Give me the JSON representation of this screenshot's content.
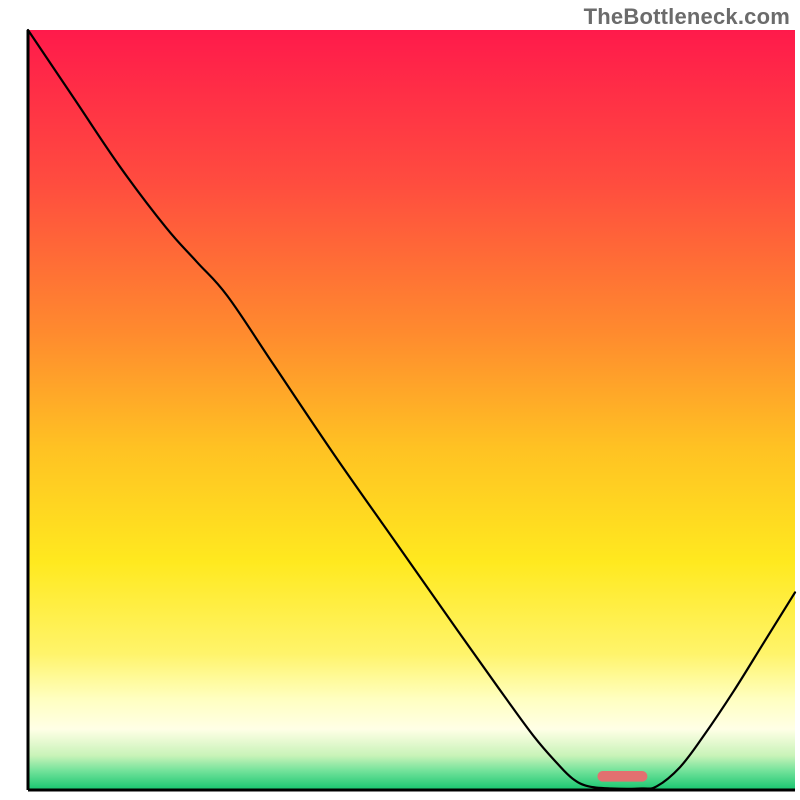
{
  "watermark": "TheBottleneck.com",
  "chart_data": {
    "type": "line",
    "title": "",
    "xlabel": "",
    "ylabel": "",
    "xlim": [
      0,
      100
    ],
    "ylim": [
      0,
      100
    ],
    "axes": {
      "grid": false,
      "ticks": [],
      "left_line": true,
      "bottom_line": true
    },
    "background_gradient": {
      "stops": [
        {
          "offset": 0.0,
          "color": "#ff1a4b"
        },
        {
          "offset": 0.2,
          "color": "#ff4c3f"
        },
        {
          "offset": 0.4,
          "color": "#ff8b2e"
        },
        {
          "offset": 0.55,
          "color": "#ffc223"
        },
        {
          "offset": 0.7,
          "color": "#ffe91f"
        },
        {
          "offset": 0.82,
          "color": "#fff46a"
        },
        {
          "offset": 0.88,
          "color": "#ffffc0"
        },
        {
          "offset": 0.92,
          "color": "#ffffe6"
        },
        {
          "offset": 0.955,
          "color": "#c8f3b8"
        },
        {
          "offset": 0.975,
          "color": "#72e29a"
        },
        {
          "offset": 1.0,
          "color": "#17c56f"
        }
      ]
    },
    "series": [
      {
        "name": "bottleneck-curve",
        "color": "#000000",
        "width": 2.2,
        "points_xy": [
          [
            0.0,
            100.0
          ],
          [
            6.0,
            91.0
          ],
          [
            12.0,
            82.0
          ],
          [
            18.0,
            74.0
          ],
          [
            22.0,
            69.5
          ],
          [
            26.0,
            65.0
          ],
          [
            32.0,
            56.0
          ],
          [
            40.0,
            44.0
          ],
          [
            48.0,
            32.5
          ],
          [
            56.0,
            21.0
          ],
          [
            62.0,
            12.5
          ],
          [
            66.0,
            7.0
          ],
          [
            69.0,
            3.5
          ],
          [
            71.0,
            1.5
          ],
          [
            73.0,
            0.5
          ],
          [
            76.0,
            0.2
          ],
          [
            80.0,
            0.2
          ],
          [
            82.0,
            0.5
          ],
          [
            85.0,
            3.0
          ],
          [
            88.0,
            7.0
          ],
          [
            92.0,
            13.0
          ],
          [
            96.0,
            19.5
          ],
          [
            100.0,
            26.0
          ]
        ]
      }
    ],
    "marker": {
      "name": "optimal-range-marker",
      "shape": "rounded-rect",
      "color": "#e27070",
      "x_center": 77.5,
      "y_center": 1.8,
      "width_pct": 6.5,
      "height_pct": 1.4
    }
  }
}
